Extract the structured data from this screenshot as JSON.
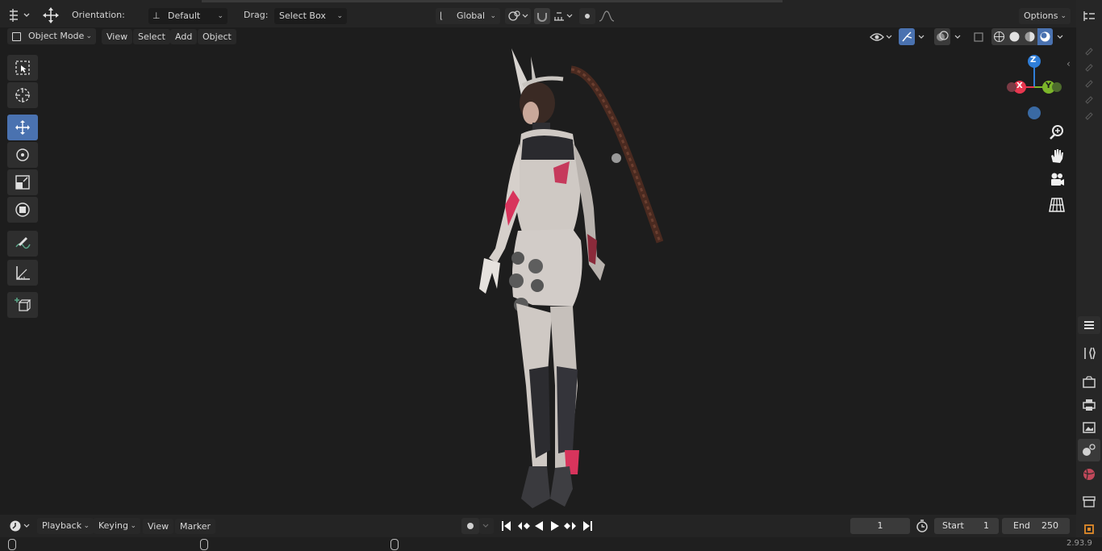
{
  "header": {
    "orientation_label": "Orientation:",
    "orientation_value": "Default",
    "drag_label": "Drag:",
    "drag_value": "Select Box",
    "transform_space": "Global",
    "options_label": "Options"
  },
  "viewport_header": {
    "mode": "Object Mode",
    "menus": [
      "View",
      "Select",
      "Add",
      "Object"
    ]
  },
  "toolbar": {
    "tools": [
      "select-box",
      "cursor",
      "move",
      "rotate",
      "scale",
      "transform",
      "annotate",
      "measure",
      "add-cube"
    ],
    "active": "move"
  },
  "gizmo": {
    "axes": {
      "z": "Z",
      "x": "X",
      "y": "Y"
    },
    "colors": {
      "z": "#2f7ed8",
      "x": "#e8374f",
      "y": "#7cb62a",
      "neg_z": "#3a6aa3"
    }
  },
  "timeline": {
    "menus": [
      "Playback",
      "Keying",
      "View",
      "Marker"
    ],
    "current_frame": "1",
    "start_label": "Start",
    "start_value": "1",
    "end_label": "End",
    "end_value": "250"
  },
  "status": {
    "version": "2.93.9"
  },
  "colors": {
    "accent": "#4a72b0",
    "viewport_bg": "#1d1d1d",
    "header_bg": "#242424"
  }
}
